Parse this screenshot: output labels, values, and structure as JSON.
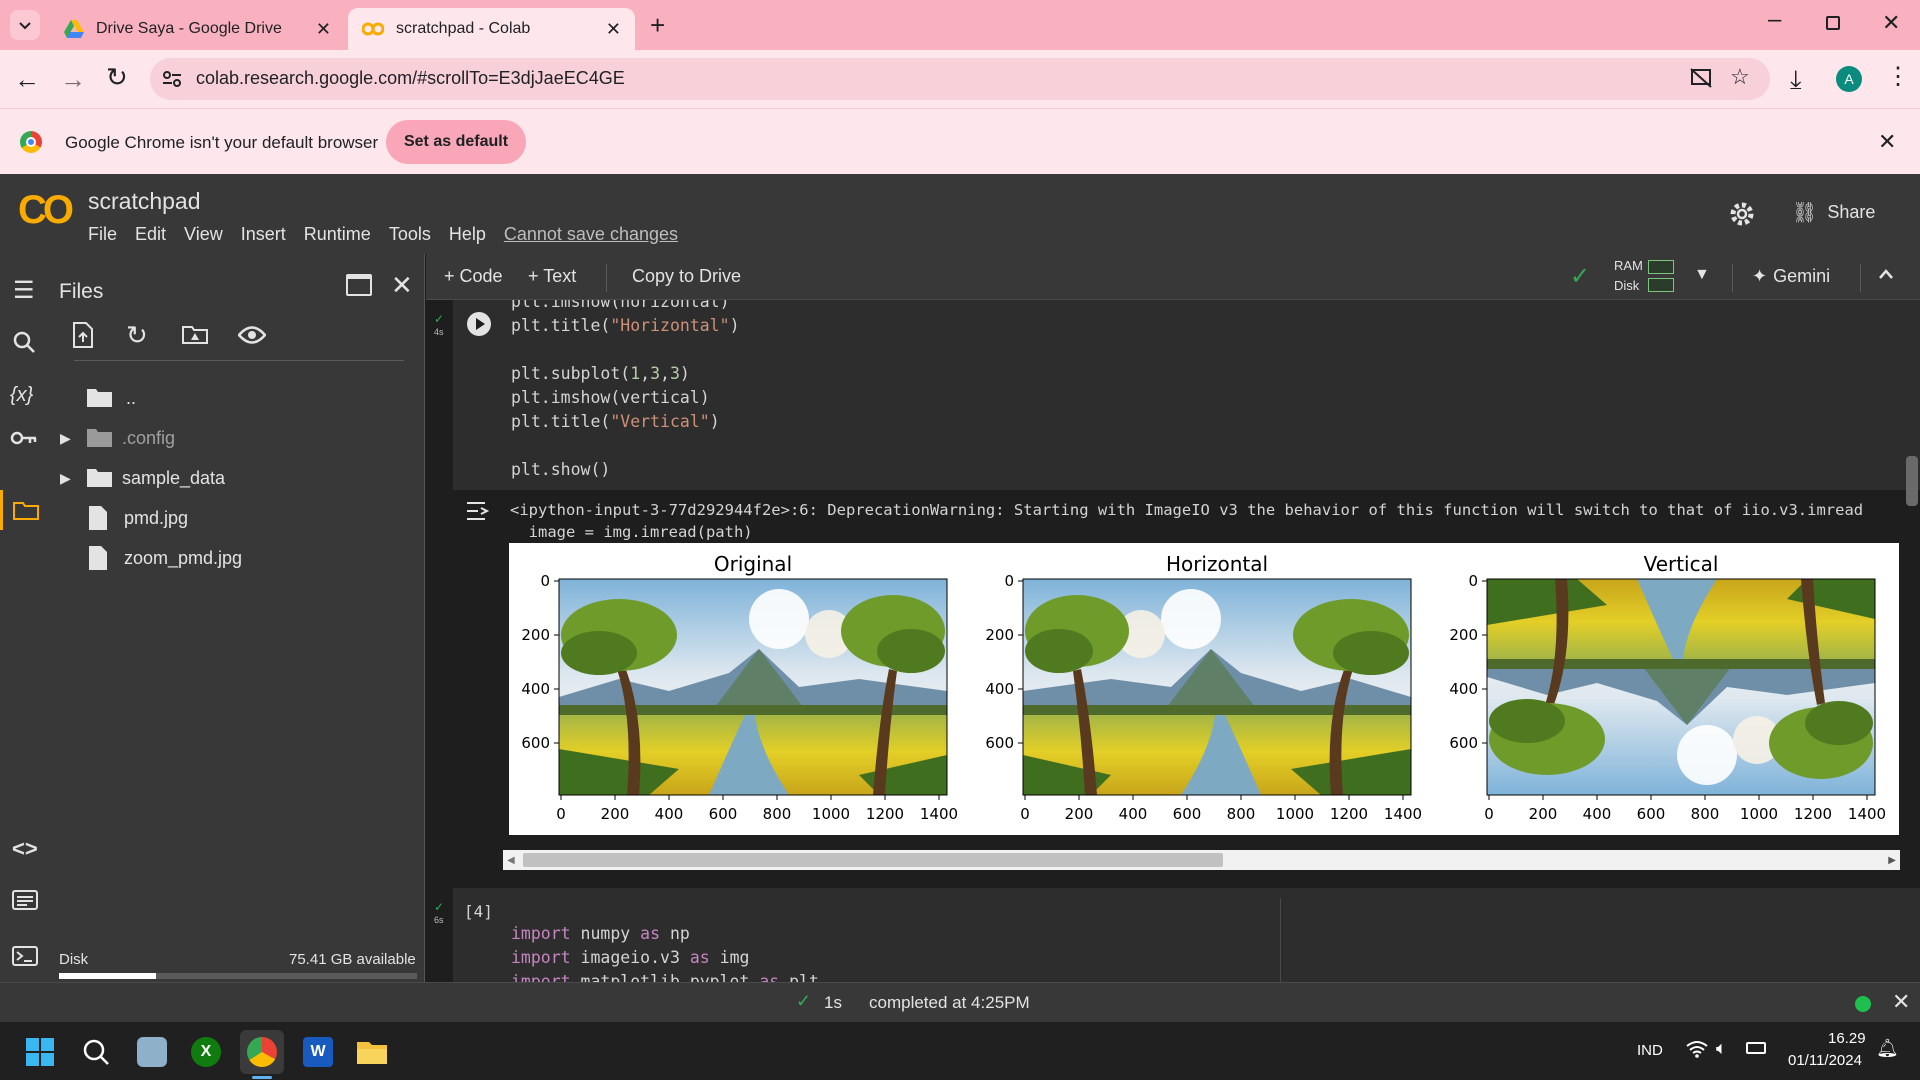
{
  "browser": {
    "tabs": [
      {
        "title": "Drive Saya - Google Drive"
      },
      {
        "title": "scratchpad - Colab"
      }
    ],
    "url": "colab.research.google.com/#scrollTo=E3djJaeEC4GE",
    "avatar": "A",
    "infobar": {
      "message": "Google Chrome isn't your default browser",
      "button": "Set as default"
    }
  },
  "colab": {
    "logo": "CO",
    "notebook_title": "scratchpad",
    "menu": [
      "File",
      "Edit",
      "View",
      "Insert",
      "Runtime",
      "Tools",
      "Help"
    ],
    "cannot_save": "Cannot save changes",
    "share": "Share",
    "toolbar": {
      "code": "+ Code",
      "text": "+ Text",
      "copy": "Copy to Drive",
      "ram": "RAM",
      "disk": "Disk",
      "gemini": "Gemini"
    }
  },
  "files": {
    "title": "Files",
    "items": [
      {
        "name": ".."
      },
      {
        "name": ".config"
      },
      {
        "name": "sample_data"
      },
      {
        "name": "pmd.jpg"
      },
      {
        "name": "zoom_pmd.jpg"
      }
    ],
    "disk_label": "Disk",
    "disk_available": "75.41 GB available",
    "disk_used_fraction": 0.27
  },
  "cell1": {
    "exec_time": "4s",
    "output_warning": "<ipython-input-3-77d292944f2e>:6: DeprecationWarning: Starting with ImageIO v3 the behavior of this function will switch to that of iio.v3.imread",
    "output_line2": "  image = img.imread(path)"
  },
  "cell2": {
    "exec_count": "[4]",
    "exec_time": "6s"
  },
  "plots": {
    "titles": [
      "Original",
      "Horizontal",
      "Vertical"
    ],
    "yticks": [
      "0",
      "200",
      "400",
      "600"
    ],
    "xticks": [
      "0",
      "200",
      "400",
      "600",
      "800",
      "1000",
      "1200",
      "1400"
    ]
  },
  "status": {
    "time": "1s",
    "message": "completed at 4:25PM"
  },
  "taskbar": {
    "lang": "IND",
    "time": "16.29",
    "date": "01/11/2024"
  }
}
